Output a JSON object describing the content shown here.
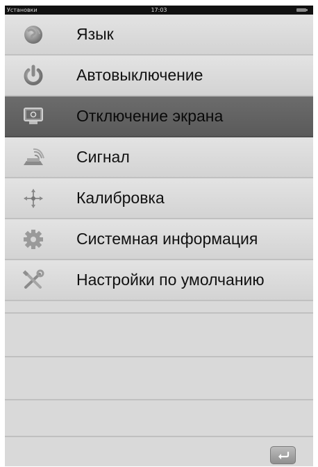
{
  "status_bar": {
    "title": "Установки",
    "time": "17:03"
  },
  "menu": {
    "items": [
      {
        "label": "Язык",
        "icon": "language-icon",
        "selected": false
      },
      {
        "label": "Автовыключение",
        "icon": "power-icon",
        "selected": false
      },
      {
        "label": "Отключение экрана",
        "icon": "monitor-icon",
        "selected": true
      },
      {
        "label": "Сигнал",
        "icon": "signal-icon",
        "selected": false
      },
      {
        "label": "Калибровка",
        "icon": "calibration-icon",
        "selected": false
      },
      {
        "label": "Системная информация",
        "icon": "gear-icon",
        "selected": false
      },
      {
        "label": "Настройки по умолчанию",
        "icon": "tools-icon",
        "selected": false
      }
    ]
  },
  "footer": {
    "back_icon": "back-arrow-icon"
  }
}
